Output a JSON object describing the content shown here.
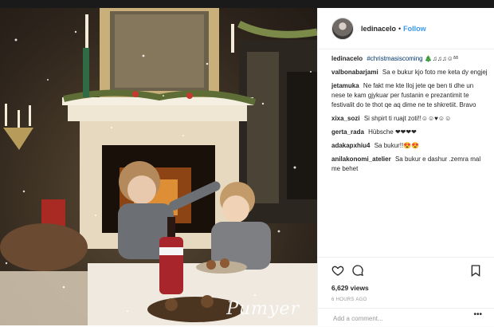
{
  "post": {
    "username": "ledinacelo",
    "separator": "•",
    "follow_label": "Follow",
    "watermark": "Pumyer",
    "caption": {
      "user": "ledinacelo",
      "hashtag": "#christmasiscoming",
      "emoji": "🎄♫♫♫☺ᵟᵟ"
    },
    "comments": [
      {
        "user": "valbonabarjami",
        "text": "Sa e bukur kjo foto me keta dy engjej"
      },
      {
        "user": "jetamuka",
        "text": "Ne fakt me kte lloj jete qe ben ti dhe un nese te kam gjykuar per fustanin e prezantimit te festivalit do te thot qe aq dime ne te shkretiit. Bravo"
      },
      {
        "user": "xixa_sozi",
        "text": "Si shpirt ti ruajt zoti!!☺☺♥☺☺"
      },
      {
        "user": "gerta_rada",
        "text": "Hübsche ❤❤❤❤"
      },
      {
        "user": "adakapxhiu4",
        "text": "Sa bukur!!😍😍"
      },
      {
        "user": "anilakonomi_atelier",
        "text": "Sa bukur e dashur .zemra mal me behet"
      }
    ],
    "views": "6,629 views",
    "time": "6 HOURS AGO",
    "add_comment_placeholder": "Add a comment...",
    "more_label": "•••"
  },
  "icons": [
    "heart-icon",
    "comment-icon",
    "bookmark-icon",
    "more-icon"
  ]
}
